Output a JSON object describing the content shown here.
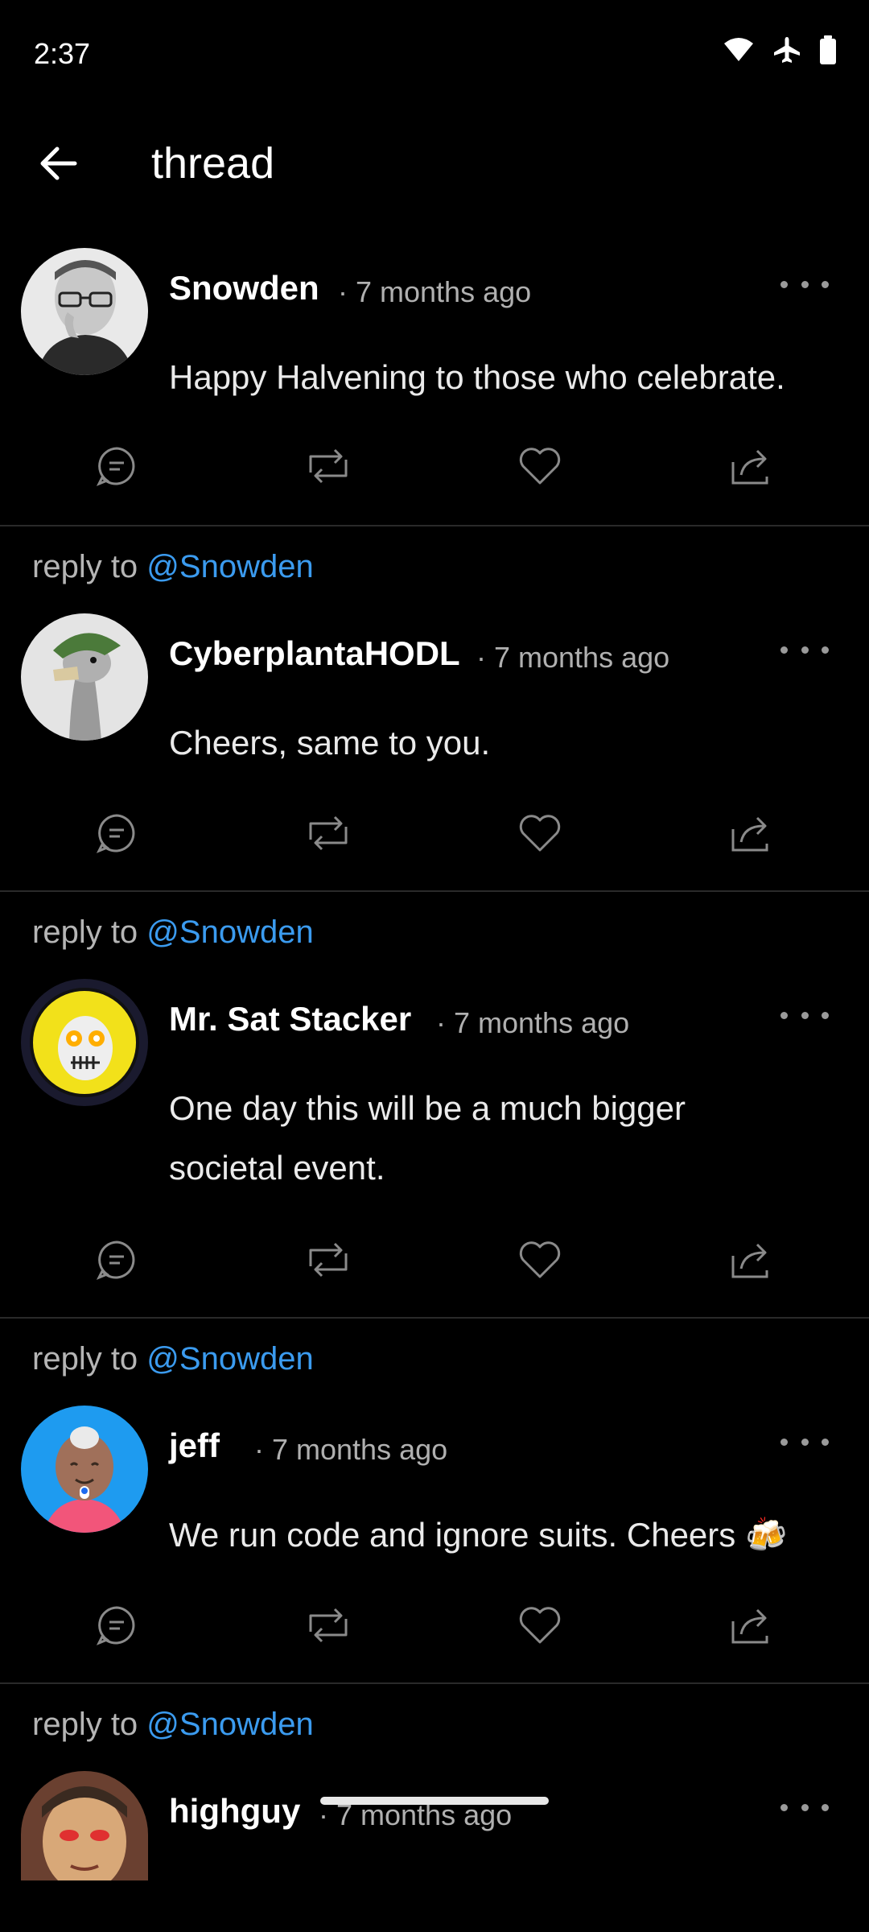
{
  "status_bar": {
    "time": "2:37",
    "icons": [
      "wifi-icon",
      "airplane-icon",
      "battery-icon"
    ]
  },
  "header": {
    "title": "thread",
    "back_icon": "arrow-left-icon"
  },
  "colors": {
    "background": "#000000",
    "link": "#3b9bef",
    "divider": "#2a2a2a"
  },
  "posts": [
    {
      "author": "Snowden",
      "time": "· 7 months ago",
      "text": "Happy Halvening to those who celebrate."
    },
    {
      "reply_prefix": "reply to",
      "reply_handle": "@Snowden",
      "author": "CyberplantaHODL",
      "time": "· 7 months ago",
      "text": "Cheers, same to you."
    },
    {
      "reply_prefix": "reply to",
      "reply_handle": "@Snowden",
      "author": "Mr. Sat Stacker",
      "time": "· 7 months ago",
      "text": "One day this will be a much bigger societal event."
    },
    {
      "reply_prefix": "reply to",
      "reply_handle": "@Snowden",
      "author": "jeff",
      "time": "· 7 months ago",
      "text": "We run code and ignore suits. Cheers 🍻"
    },
    {
      "reply_prefix": "reply to",
      "reply_handle": "@Snowden",
      "author": "highguy",
      "time": "· 7 months ago",
      "text": ""
    }
  ],
  "action_icons": [
    "comment-icon",
    "repost-icon",
    "heart-icon",
    "share-icon"
  ]
}
